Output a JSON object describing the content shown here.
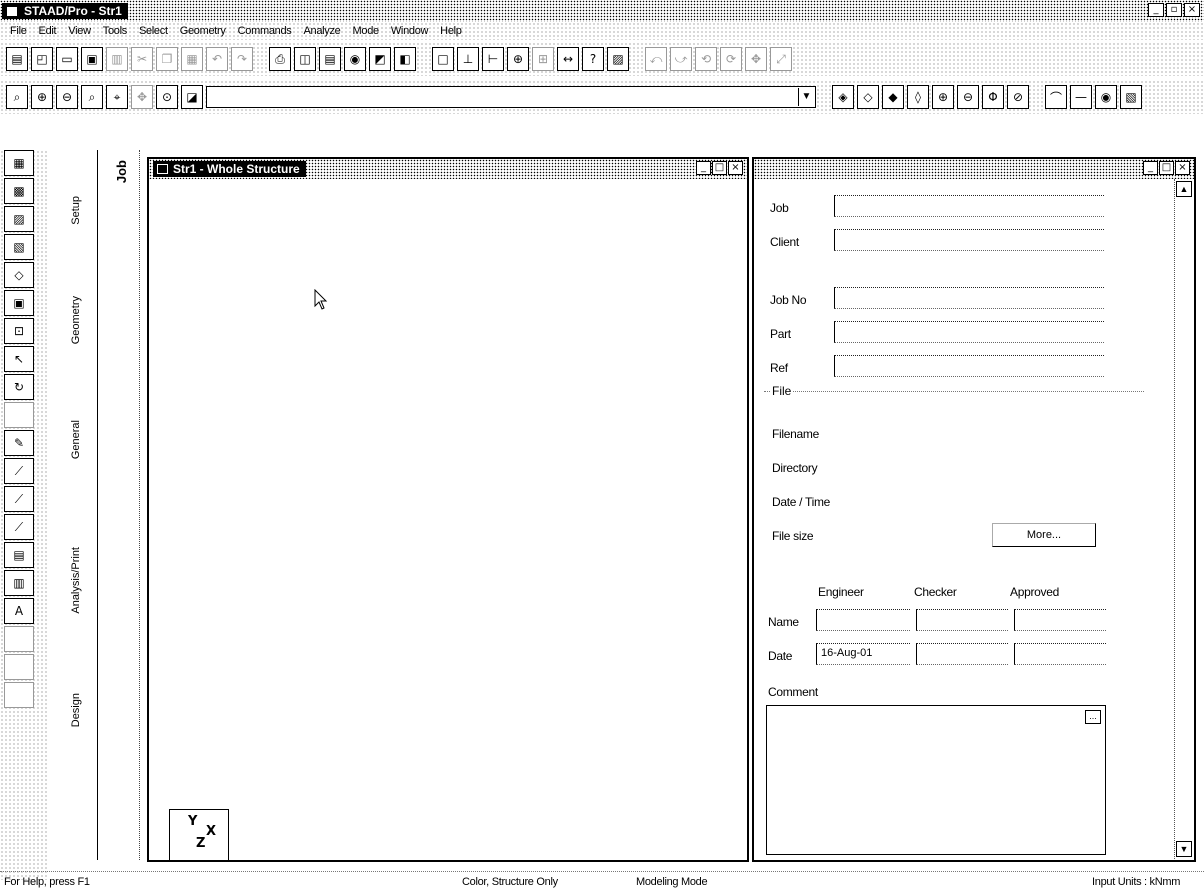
{
  "app": {
    "title": "STAAD/Pro - Str1",
    "window_buttons": [
      "_",
      "▫",
      "×"
    ]
  },
  "menu": [
    "File",
    "Edit",
    "View",
    "Tools",
    "Select",
    "Geometry",
    "Commands",
    "Analyze",
    "Mode",
    "Window",
    "Help"
  ],
  "toolbar1": {
    "icons": [
      "new-file-icon",
      "open-file-icon",
      "open-folder-icon",
      "save-icon",
      "print-icon",
      "cut-icon",
      "copy-icon",
      "paste-icon",
      "undo-icon",
      "redo-icon",
      "print-preview-icon",
      "page-setup-icon",
      "report-icon",
      "export-icon",
      "view-3d-icon",
      "toggle-icon",
      "frame-icon",
      "support-icon",
      "load-icon",
      "node-icon",
      "beam-icon",
      "dimension-icon",
      "help-icon",
      "graph-icon",
      "rotate-x-icon",
      "rotate-y-icon",
      "rotate-z-icon",
      "rotate-neg-icon",
      "pan-icon",
      "zoom-extents-icon"
    ]
  },
  "toolbar2": {
    "icons": [
      "zoom-window-icon",
      "zoom-in-icon",
      "zoom-out-icon",
      "zoom-dynamic-icon",
      "zoom-prev-icon",
      "pan-view-icon",
      "magnify-icon",
      "display-icon"
    ],
    "combo_value": "",
    "icons_right": [
      "iso-view-icon",
      "front-view-icon",
      "back-view-icon",
      "side-view-icon",
      "top-view-icon",
      "bottom-view-icon",
      "plan-view-icon",
      "section-view-icon",
      "beam-view-icon",
      "line-view-icon",
      "eye-view-icon",
      "render-icon"
    ]
  },
  "left_tabs": {
    "setup": "Setup",
    "geometry": "Geometry",
    "general": "General",
    "analysis_print": "Analysis/Print",
    "design": "Design",
    "job": "Job"
  },
  "structure_window": {
    "title": "Str1 - Whole Structure",
    "axis": {
      "y": "Y",
      "x": "X",
      "z": "Z"
    }
  },
  "job_info": {
    "fields": {
      "job": "Job",
      "client": "Client",
      "job_no": "Job No",
      "part": "Part",
      "ref": "Ref"
    },
    "file_group": "File",
    "file_rows": {
      "filename": "Filename",
      "directory": "Directory",
      "datetime": "Date / Time",
      "filesize": "File size"
    },
    "more_button": "More...",
    "people_headers": {
      "engineer": "Engineer",
      "checker": "Checker",
      "approved": "Approved"
    },
    "name_label": "Name",
    "date_label": "Date",
    "date_value": "16-Aug-01",
    "comment_label": "Comment",
    "memo_ellipsis": "..."
  },
  "status": {
    "help": "For Help, press F1",
    "color": "Color, Structure Only",
    "mode": "Modeling Mode",
    "units": "Input Units : kNmm"
  }
}
